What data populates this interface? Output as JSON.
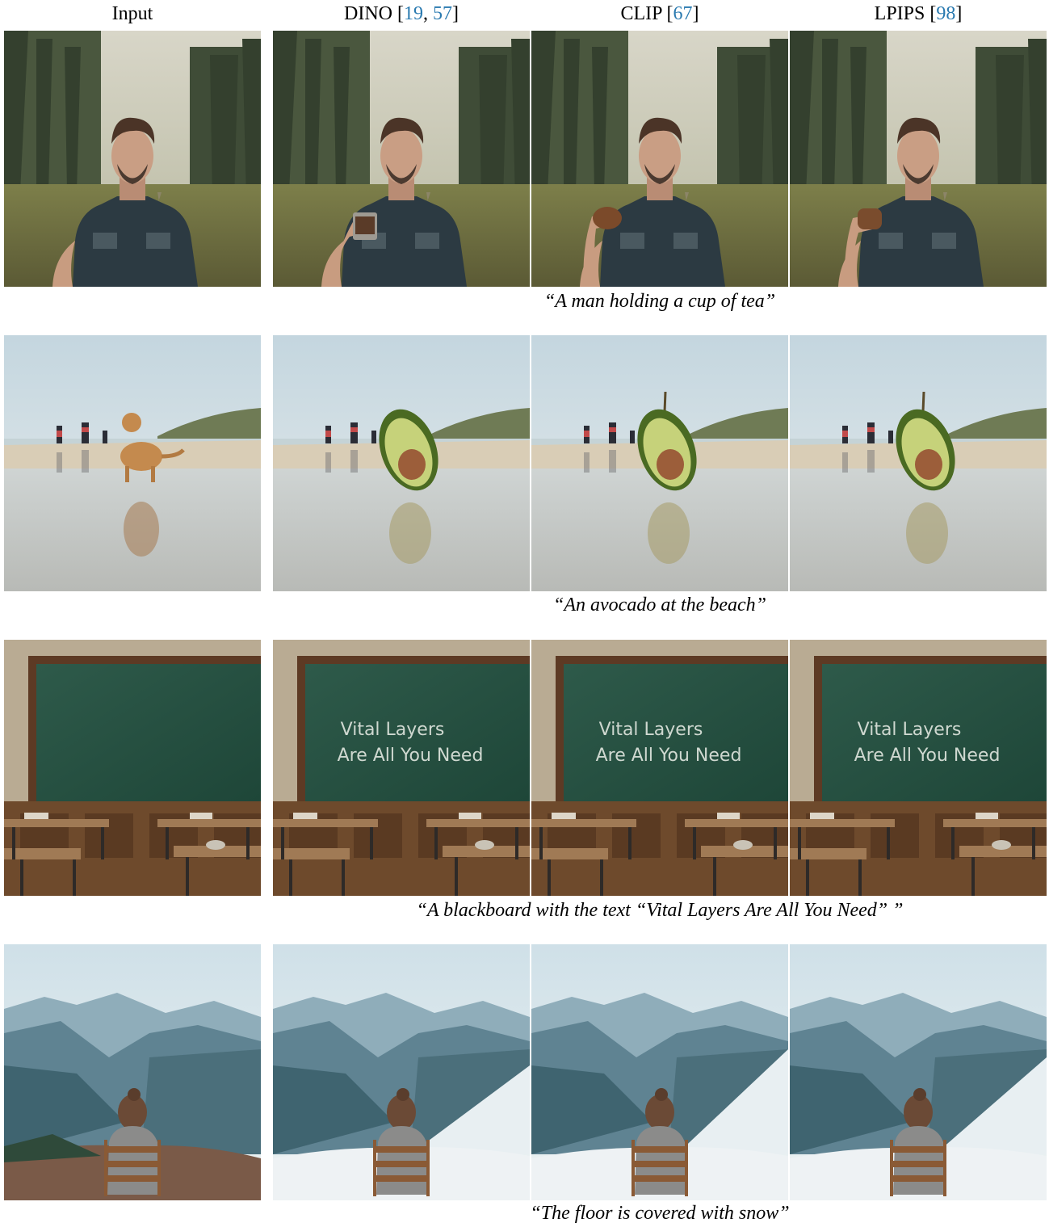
{
  "columns": {
    "input": {
      "label": "Input"
    },
    "dino": {
      "label": "DINO [",
      "cite_a": "19",
      "sep": ", ",
      "cite_b": "57",
      "close": "]"
    },
    "clip": {
      "label": "CLIP [",
      "cite_a": "67",
      "close": "]"
    },
    "lpips": {
      "label": "LPIPS [",
      "cite_a": "98",
      "close": "]"
    }
  },
  "rows": [
    {
      "caption": "“A man holding a cup of tea”",
      "scene": "portrait-man-forest"
    },
    {
      "caption": "“An avocado at the beach”",
      "scene": "beach-cat-avocado"
    },
    {
      "caption": "“A blackboard with the text “Vital Layers Are All You Need” ”",
      "scene": "classroom-blackboard"
    },
    {
      "caption": "“The floor is covered with snow”",
      "scene": "woman-mountain-chair"
    }
  ],
  "blackboard_text": {
    "line1": "Vital Layers",
    "line2": "Are All You Need"
  }
}
